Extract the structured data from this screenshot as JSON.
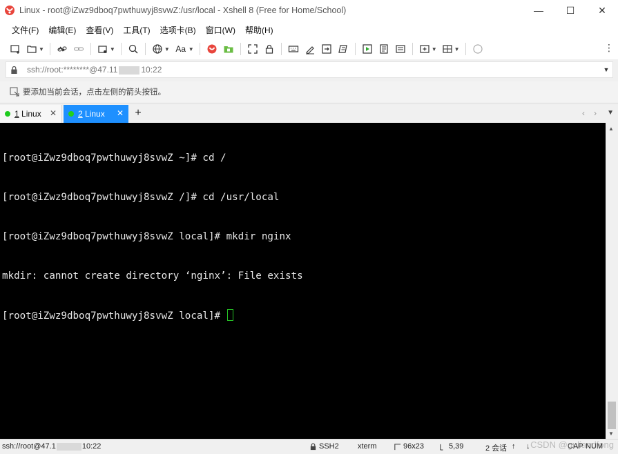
{
  "window": {
    "title": "Linux - root@iZwz9dboq7pwthuwyj8svwZ:/usr/local - Xshell 8 (Free for Home/School)",
    "minimize": "—",
    "maximize": "☐",
    "close": "✕"
  },
  "menu": [
    "文件(F)",
    "编辑(E)",
    "查看(V)",
    "工具(T)",
    "选项卡(B)",
    "窗口(W)",
    "帮助(H)"
  ],
  "toolbar": {
    "font_label": "Aa"
  },
  "address": {
    "prefix": "ssh://root:********@47.11",
    "suffix": "10:22",
    "dropdown": "▼"
  },
  "hint": {
    "text": "要添加当前会话，点击左侧的箭头按钮。"
  },
  "tabs": [
    {
      "num": "1",
      "label": " Linux",
      "close": "✕",
      "active": false
    },
    {
      "num": "2",
      "label": " Linux",
      "close": "✕",
      "active": true
    }
  ],
  "tab_add": "+",
  "tab_nav": {
    "prev": "‹",
    "next": "›",
    "menu": "▼"
  },
  "terminal": {
    "lines": [
      "[root@iZwz9dboq7pwthuwyj8svwZ ~]# cd /",
      "[root@iZwz9dboq7pwthuwyj8svwZ /]# cd /usr/local",
      "[root@iZwz9dboq7pwthuwyj8svwZ local]# mkdir nginx",
      "mkdir: cannot create directory ‘nginx’: File exists",
      "[root@iZwz9dboq7pwthuwyj8svwZ local]# "
    ]
  },
  "status": {
    "conn_prefix": "ssh://root@47.1",
    "conn_suffix": "10:22",
    "protocol": "SSH2",
    "terminal_type": "xterm",
    "size": "96x23",
    "cursor_pos": "5,39",
    "sessions": "2 会话",
    "caps": "CAP",
    "num": "NUM",
    "watermark": "CSDN @guliandfong"
  },
  "colors": {
    "tab_active": "#1e90ff",
    "terminal_bg": "#000000",
    "cursor": "#26c226",
    "status_dot": "#1ecb1e"
  }
}
